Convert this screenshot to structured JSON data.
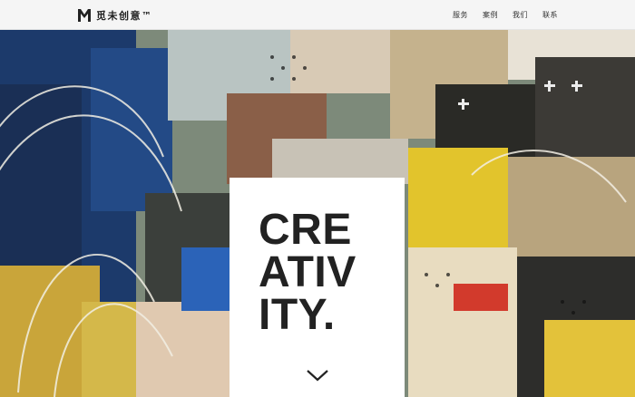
{
  "nav": {
    "brand_text": "觅未创意™",
    "brand_logo_icon": "m-logo-icon",
    "links": [
      "服务",
      "案例",
      "我们",
      "联系"
    ]
  },
  "hero": {
    "title_lines": [
      "CRE",
      "ATIV",
      "ITY."
    ],
    "scroll_icon": "chevron-down-icon",
    "background": "street-art collage image"
  },
  "colors": {
    "navbar_bg": "#f5f5f5",
    "card_bg": "#ffffff",
    "title_text": "#222222"
  }
}
